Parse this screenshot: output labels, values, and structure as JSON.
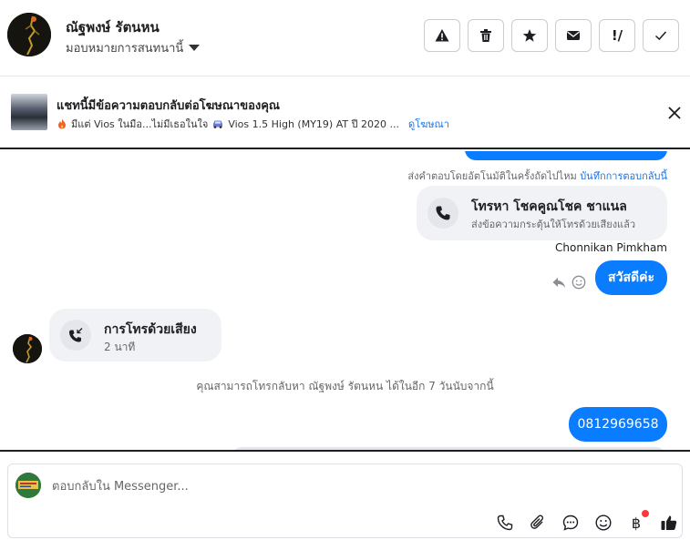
{
  "header": {
    "contact_name": "ณัฐพงษ์ รัตนหน",
    "assign_label": "มอบหมายการสนทนานี้",
    "actions": [
      {
        "name": "spam-button",
        "icon": "warning-icon"
      },
      {
        "name": "delete-button",
        "icon": "trash-icon"
      },
      {
        "name": "star-button",
        "icon": "star-icon"
      },
      {
        "name": "mark-unread-button",
        "icon": "envelope-icon"
      },
      {
        "name": "follow-up-button",
        "icon": "follow-up-icon",
        "label": "!/"
      },
      {
        "name": "mark-done-button",
        "icon": "check-icon"
      }
    ]
  },
  "ad_banner": {
    "title": "แชทนี้มีข้อความตอบกลับต่อโฆษณาของคุณ",
    "subtitle": "มีแต่ Vios ในมือ...ไม่มีเธอในใจ",
    "car_text": "Vios 1.5 High (MY19) AT ปี 2020 ...",
    "link": "ดูโฆษณา"
  },
  "conversation": {
    "auto_reply_text": "ส่งคำตอบโดยอัตโนมัติในครั้งถัดไปไหม",
    "auto_reply_link": "บันทึกการตอบกลับนี้",
    "outgoing_call": {
      "title": "โทรหา โชคคูณโชค ชาแนล",
      "subtitle": "ส่งข้อความกระตุ้นให้โทรด้วยเสียงแล้ว"
    },
    "sender_name": "Chonnikan Pimkham",
    "hello_message": "สวัสดีค่ะ",
    "incoming_call": {
      "title": "การโทรด้วยเสียง",
      "duration": "2 นาที"
    },
    "callback_note": "คุณสามารถโทรกลับหา ณัฐพงษ์ รัตนหน ได้ในอีก 7 วันนับจากนี้",
    "phone_message": "0812969658"
  },
  "composer": {
    "placeholder": "ตอบกลับใน Messenger...",
    "baht_symbol": "฿"
  },
  "colors": {
    "accent": "#0a7cff",
    "link": "#1b74e4",
    "bubble_grey": "#f0f2f5",
    "notify_dot": "#fa383e"
  }
}
